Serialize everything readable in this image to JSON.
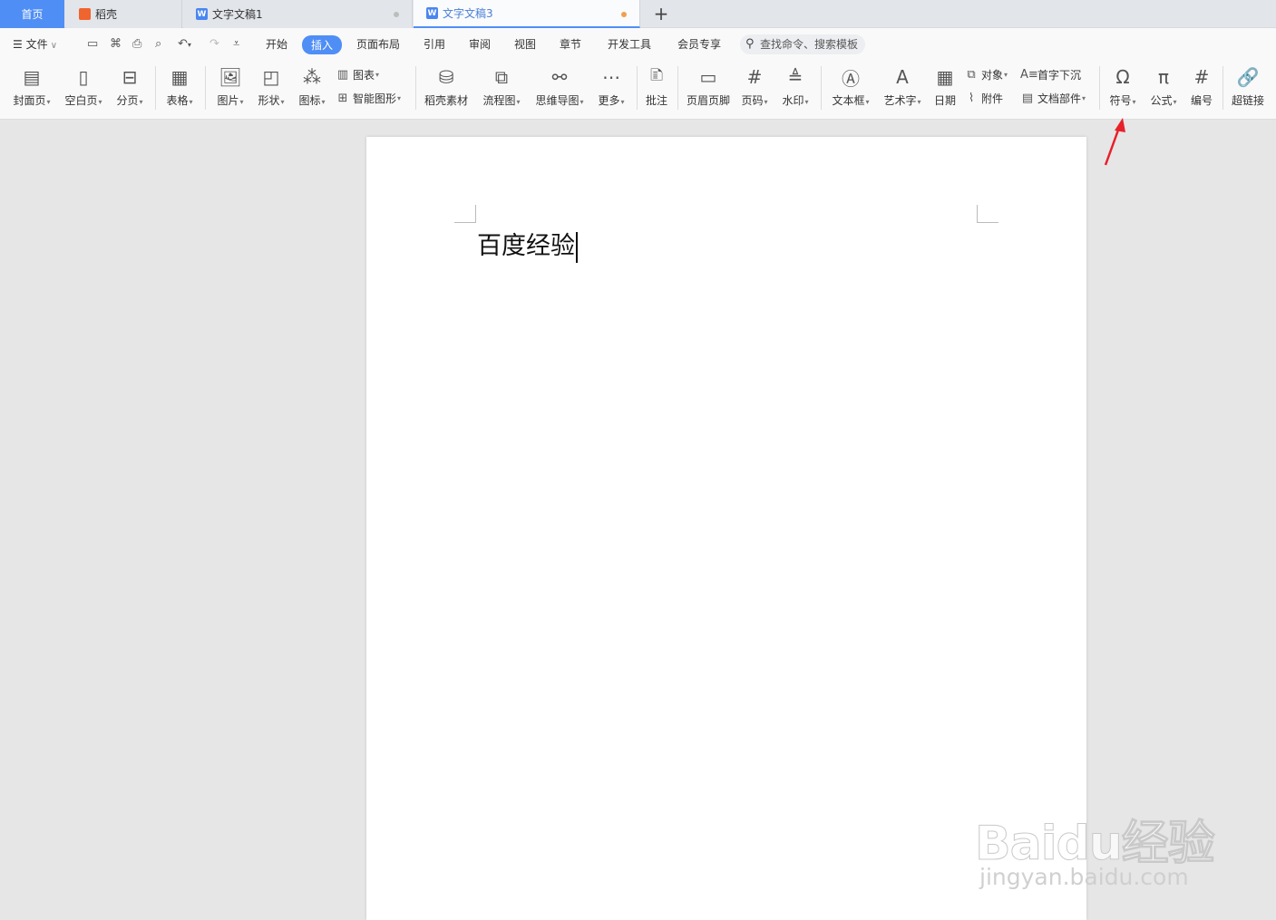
{
  "tabs": {
    "home": "首页",
    "daoke": "稻壳",
    "doc1": "文字文稿1",
    "doc3": "文字文稿3",
    "new_tab": "+"
  },
  "menu": {
    "file": "文件",
    "items": [
      "开始",
      "插入",
      "页面布局",
      "引用",
      "审阅",
      "视图",
      "章节",
      "开发工具",
      "会员专享"
    ],
    "active": "插入",
    "search_placeholder": "查找命令、搜索模板"
  },
  "ribbon": {
    "cover_page": "封面页",
    "blank_page": "空白页",
    "page_break": "分页",
    "table": "表格",
    "picture": "图片",
    "shape": "形状",
    "icon": "图标",
    "chart": "图表",
    "smart_art": "智能图形",
    "daoke_material": "稻壳素材",
    "flowchart": "流程图",
    "mindmap": "思维导图",
    "more": "更多",
    "comment": "批注",
    "header_footer": "页眉页脚",
    "page_number": "页码",
    "watermark": "水印",
    "textbox": "文本框",
    "wordart": "艺术字",
    "date": "日期",
    "object": "对象",
    "attachment": "附件",
    "dropcap": "首字下沉",
    "doc_parts": "文档部件",
    "symbol": "符号",
    "formula": "公式",
    "numbering": "编号",
    "hyperlink": "超链接"
  },
  "document": {
    "text": "百度经验"
  },
  "watermark": {
    "logo": "Baidu经验",
    "url": "jingyan.baidu.com"
  },
  "colors": {
    "accent": "#4f8ef5",
    "arrow": "#e8202a"
  }
}
